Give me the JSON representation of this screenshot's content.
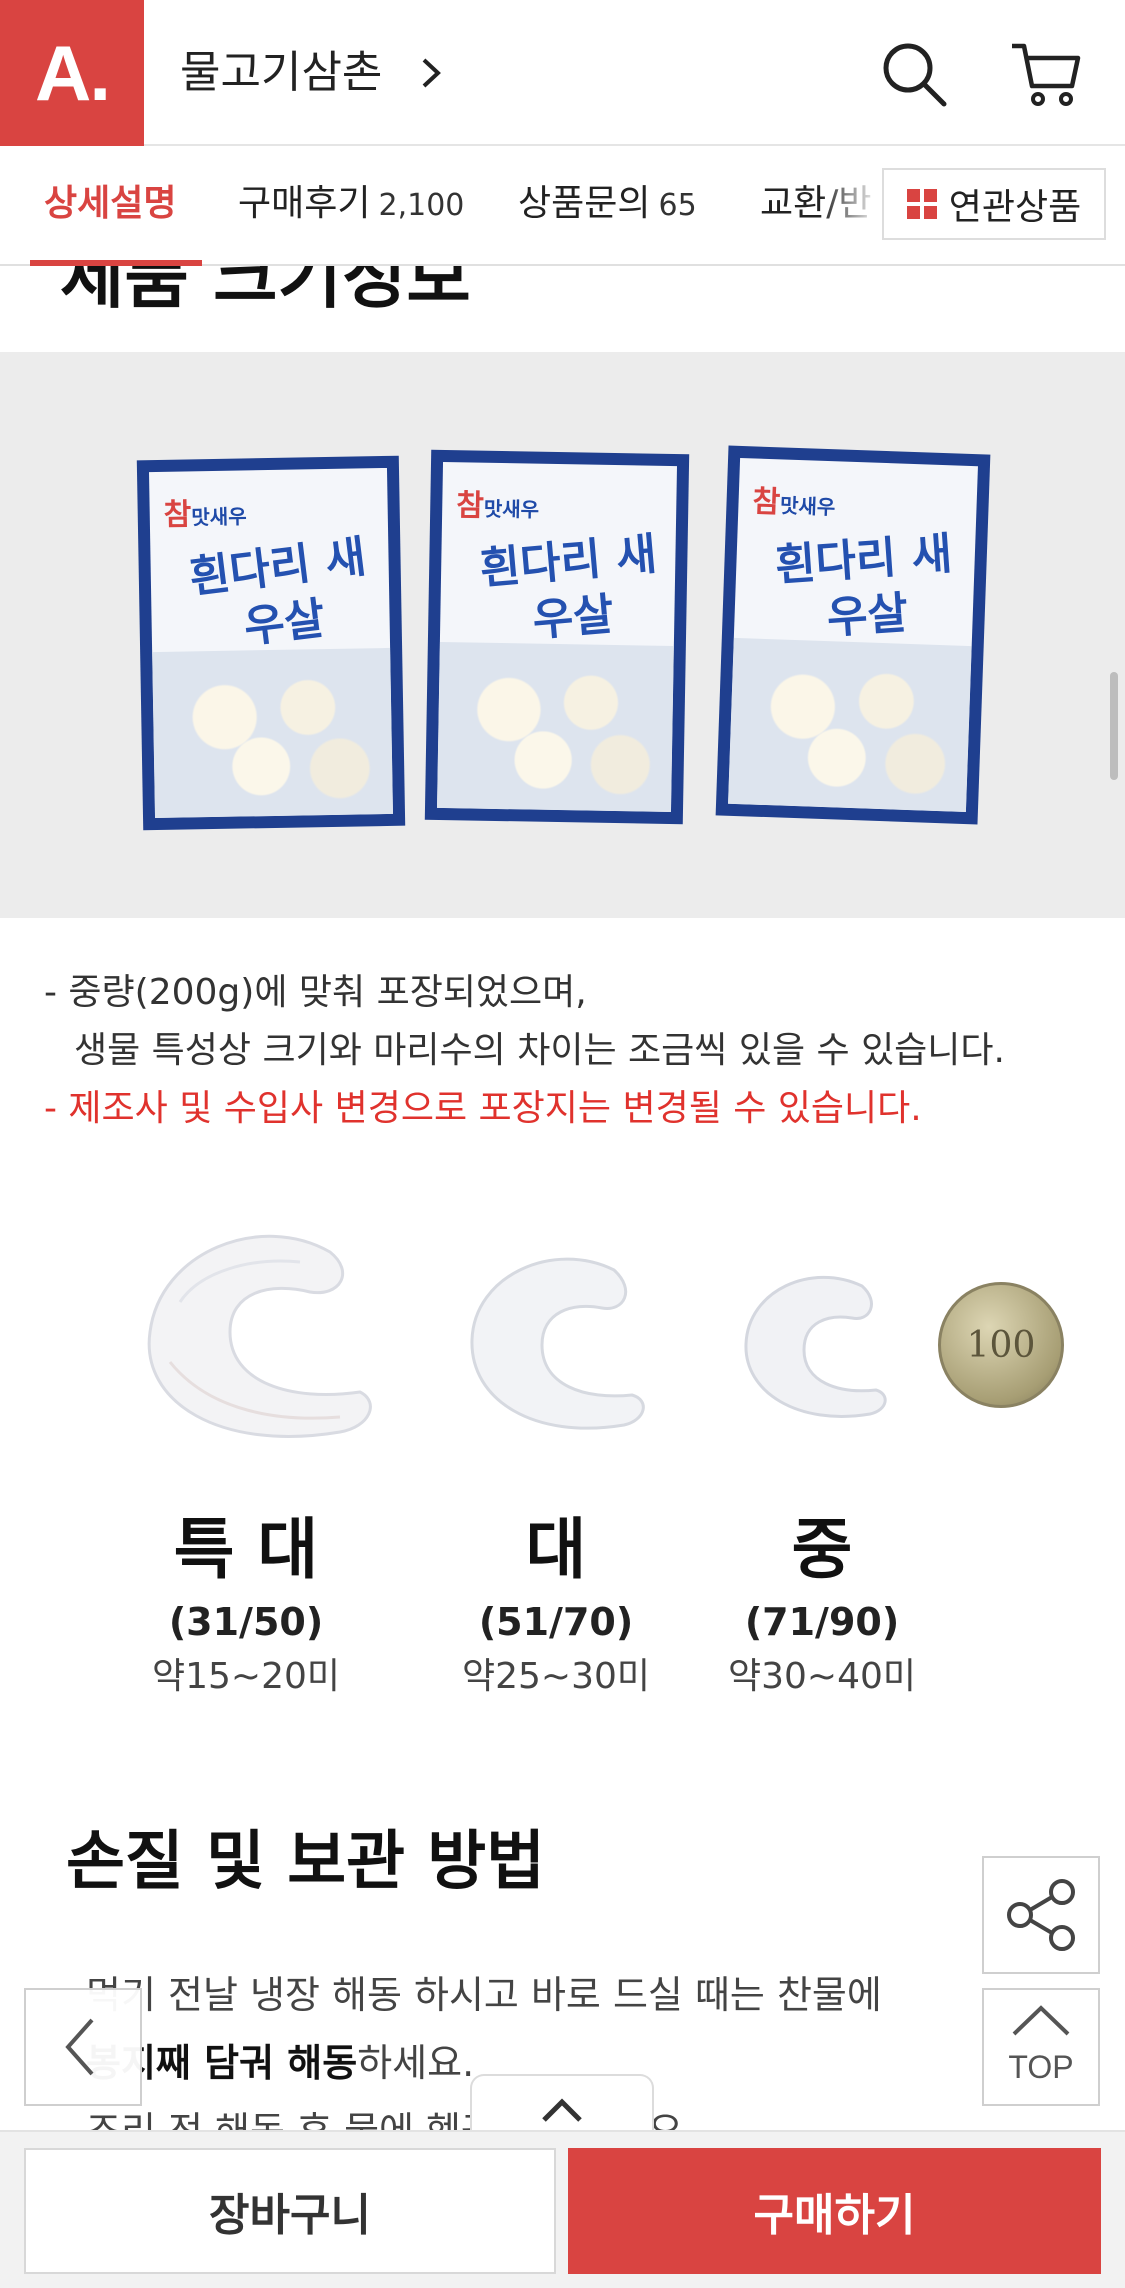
{
  "header": {
    "logo": "A.",
    "store_name": "물고기삼촌",
    "icons": [
      "search-icon",
      "cart-icon"
    ],
    "accent_color": "#d94441"
  },
  "tabs": {
    "items": [
      {
        "label": "상세설명",
        "count": ""
      },
      {
        "label": "구매후기",
        "count": "2,100"
      },
      {
        "label": "상품문의",
        "count": "65"
      },
      {
        "label": "교환/반",
        "count": ""
      }
    ],
    "related_label": "연관상품"
  },
  "content": {
    "section_heading_partial": "제품 크기정보",
    "packages": [
      {
        "brand_mark": "참",
        "brand": "맛새우",
        "title": "흰다리 새우살"
      },
      {
        "brand_mark": "참",
        "brand": "맛새우",
        "title": "흰다리 새우살"
      },
      {
        "brand_mark": "참",
        "brand": "맛새우",
        "title": "흰다리 새우살"
      }
    ],
    "desc_line1": "- 중량(200g)에 맞춰 포장되었으며,",
    "desc_line2": "생물 특성상 크기와 마리수의 차이는 조금씩 있을 수 있습니다.",
    "desc_line3": "- 제조사 및 수입사 변경으로 포장지는 변경될 수 있습니다.",
    "coin_value": "100",
    "sizes": [
      {
        "name": "특 대",
        "range": "(31/50)",
        "count": "약15~20미"
      },
      {
        "name": "대",
        "range": "(51/70)",
        "count": "약25~30미"
      },
      {
        "name": "중",
        "range": "(71/90)",
        "count": "약30~40미"
      }
    ],
    "section2_heading": "손질 및 보관 방법",
    "body_line1": "먹기 전날 냉장 해동 하시고 바로 드실 때는 찬물에",
    "body_line2_bold": "봉지째 담궈 해동",
    "body_line2_rest": "하세요.",
    "body_line3": "조리 전 해동 후 물에 헹궈 사용하세요."
  },
  "floating": {
    "top_label": "TOP"
  },
  "bottom_bar": {
    "cart_label": "장바구니",
    "buy_label": "구매하기"
  }
}
